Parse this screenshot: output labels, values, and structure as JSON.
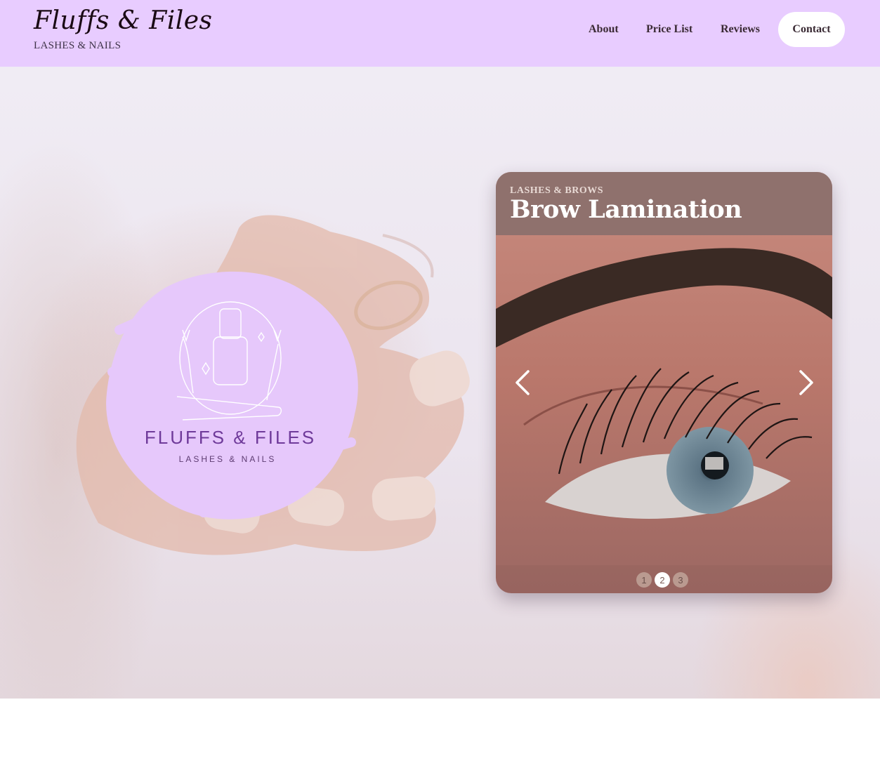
{
  "header": {
    "brand_title": "Fluffs & Files",
    "brand_subtitle": "LASHES & NAILS",
    "nav": {
      "about": "About",
      "price_list": "Price List",
      "reviews": "Reviews",
      "contact": "Contact"
    }
  },
  "hero": {
    "logo": {
      "name": "FLUFFS & FILES",
      "tagline": "LASHES & NAILS"
    },
    "carousel": {
      "category": "LASHES & BROWS",
      "title": "Brow Lamination",
      "pages": [
        "1",
        "2",
        "3"
      ],
      "active_page": 2
    }
  },
  "colors": {
    "header_bg": "#e8ccff",
    "logo_blob": "#e6c8fb",
    "logo_text": "#6f3a9a",
    "caption_bg": "#8f716d"
  },
  "icons": {
    "prev": "chevron-left-icon",
    "next": "chevron-right-icon"
  }
}
